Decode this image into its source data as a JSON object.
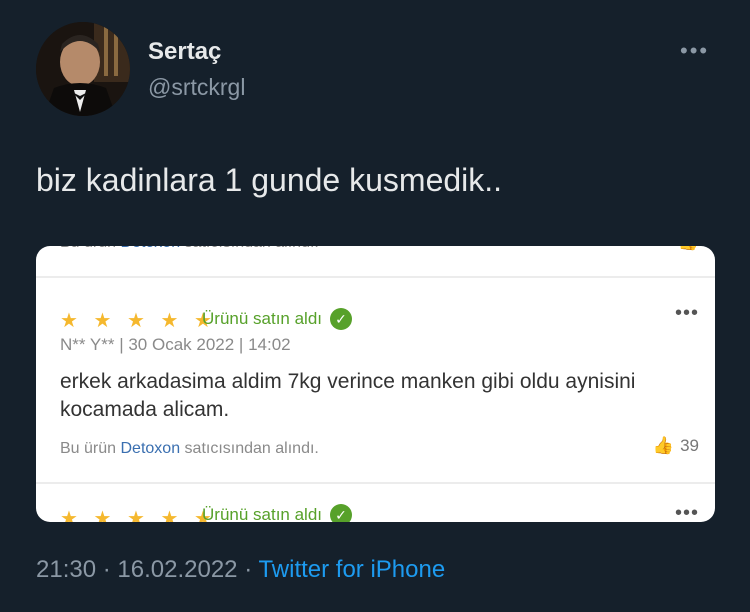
{
  "header": {
    "display_name": "Sertaç",
    "handle": "@srtckrgl",
    "more_icon": "more-horizontal-icon"
  },
  "tweet": {
    "text": "biz kadinlara 1 gunde kusmedik.."
  },
  "review_card": {
    "rating": "★ ★ ★ ★ ★",
    "purchased_label": "Ürünü satın aldı",
    "meta": "N** Y** | 30 Ocak 2022 | 14:02",
    "text": "erkek arkadasima aldim 7kg verince manken gibi oldu aynisini kocamada alicam.",
    "seller_prefix": "Bu ürün",
    "seller_name": "Detoxon",
    "seller_suffix": "satıcısından alındı.",
    "like_count": "39",
    "colors": {
      "star": "#f5b82e",
      "verified": "#57a12a",
      "seller": "#3a6fb0"
    }
  },
  "footer": {
    "time": "21:30",
    "date": "16.02.2022",
    "separator": "·",
    "source": "Twitter for iPhone"
  }
}
